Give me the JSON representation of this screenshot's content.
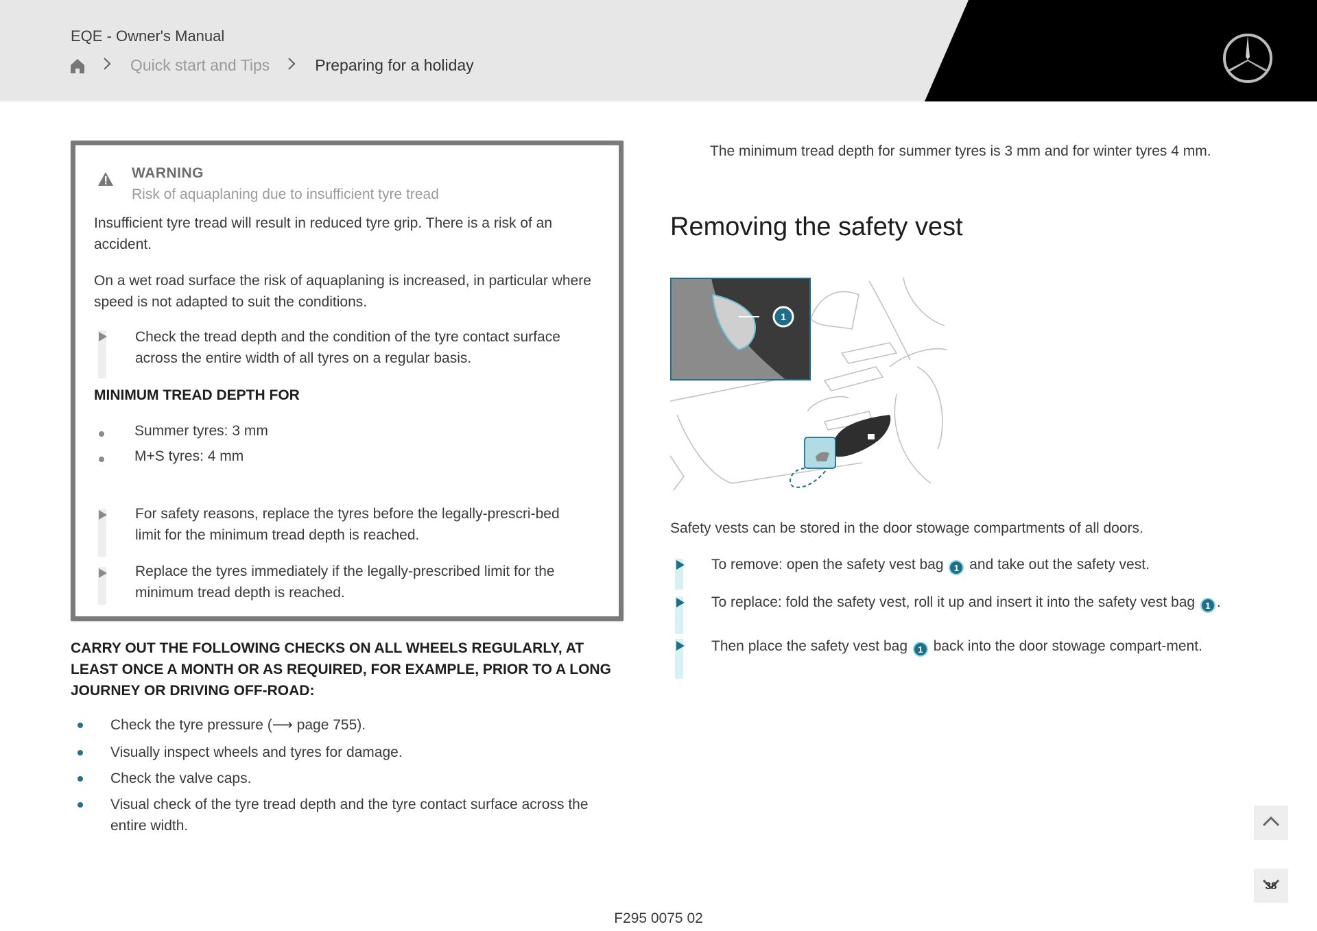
{
  "header": {
    "app_title": "EQE - Owner's Manual",
    "breadcrumb": {
      "home_icon": "home-icon",
      "separator_icon": "chevron-right-icon",
      "items": [
        {
          "label": "Quick start and Tips"
        },
        {
          "label": "Preparing for a holiday"
        }
      ]
    },
    "logo": "mercedes-star-logo"
  },
  "warning": {
    "icon": "warning-triangle-icon",
    "title": "WARNING",
    "subtitle": "Risk of aquaplaning due to insufficient tyre tread",
    "paragraphs": [
      "Insufficient tyre tread will result in reduced tyre grip. There is a risk of an accident.",
      "On a wet road surface the risk of aquaplaning is increased, in particular where speed is not adapted to suit the conditions."
    ],
    "step1": "Check the tread depth and the condition of the tyre contact surface across the entire width of all tyres on a regular basis.",
    "min_heading": "MINIMUM TREAD DEPTH FOR",
    "min_list": [
      "Summer tyres: 3 mm",
      "M+S tyres: 4 mm"
    ],
    "steps2": [
      "For safety reasons, replace the tyres before the legally-prescri-bed limit for the minimum tread depth is reached.",
      "Replace the tyres immediately if the legally-prescribed limit for the minimum tread depth is reached."
    ]
  },
  "checks": {
    "heading": "CARRY OUT THE FOLLOWING CHECKS ON ALL WHEELS REGULARLY, AT LEAST ONCE A MONTH OR AS REQUIRED, FOR EXAMPLE, PRIOR TO A LONG JOURNEY OR DRIVING OFF-ROAD:",
    "items": [
      "Check the tyre pressure (⟶ page 755).",
      "Visually inspect wheels and tyres for damage.",
      "Check the valve caps.",
      "Visual check of the tyre tread depth and the tyre contact surface across the entire width."
    ]
  },
  "right": {
    "tread_note": "The minimum tread depth for summer tyres is 3 mm and for winter tyres 4 mm.",
    "section_title": "Removing the safety vest",
    "illustration_callout": "1",
    "intro": "Safety vests can be stored in the door stowage compartments of all doors.",
    "steps": [
      {
        "before": "To remove: open the safety vest bag",
        "callout": "1",
        "after": "and take out the safety vest."
      },
      {
        "before": "To replace: fold the safety vest, roll it up and insert it into the safety vest bag",
        "callout": "1",
        "after": "."
      },
      {
        "before": "Then place the safety vest bag",
        "callout": "1",
        "after": "back into the door stowage compart-ment."
      }
    ]
  },
  "footer": {
    "figure_code": "F295 0075 02",
    "scroll_up_icon": "chevron-up-icon",
    "scroll_down_icon": "chevron-down-icon",
    "page_badge": "38"
  },
  "colors": {
    "header_bg": "#e7e7e7",
    "accent": "#1e6e8a",
    "warning_border": "#7a7a7a"
  }
}
